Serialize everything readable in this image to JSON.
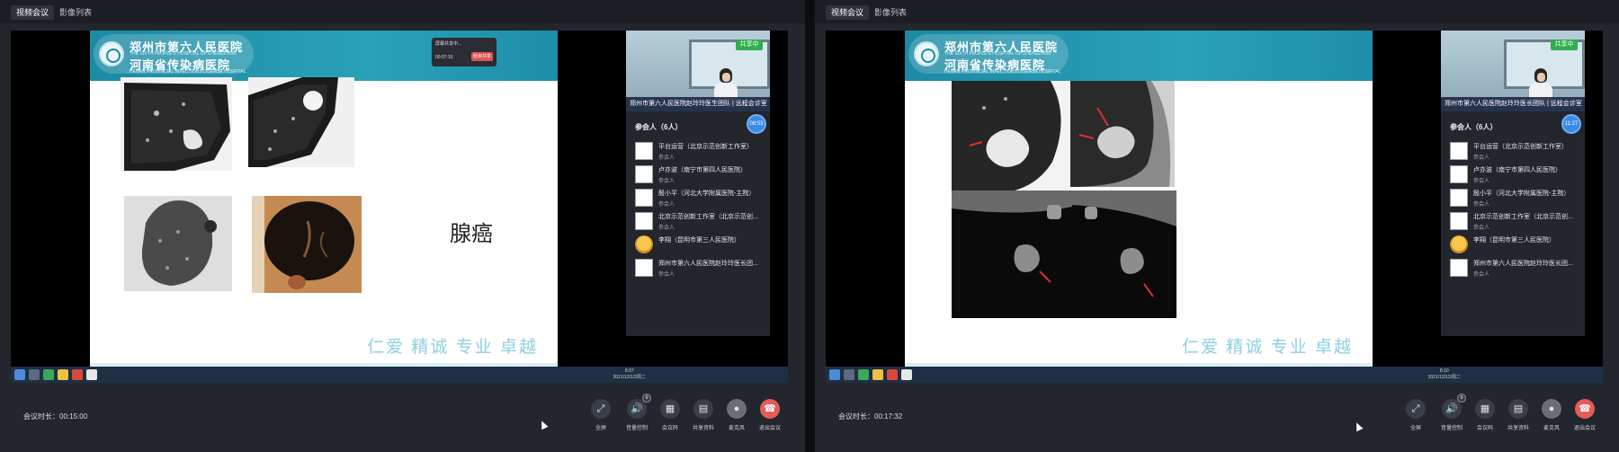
{
  "left": {
    "tabs": [
      {
        "label": "视频会议"
      },
      {
        "label": "影像列表"
      }
    ],
    "slide": {
      "hospital_name_1": "郑州市第六人民医院",
      "hospital_en_1": "THE SIXTH PEOPLE'S HOSPITAL OF ZHENGZHOU",
      "hospital_name_2": "河南省传染病医院",
      "hospital_en_2": "HENAN PROVINCIAL INFECTIOUS DISEASE HOSPITAL",
      "share_popup_title": "屏幕共享中...",
      "share_popup_time": "00:07:10",
      "share_popup_button": "结束共享",
      "diagnosis_label": "腺癌",
      "slogan": "仁爱 精诚 专业 卓越"
    },
    "taskbar_clock": {
      "time": "8:07",
      "date": "2021/12/12/周二"
    },
    "video": {
      "status_badge": "共享中",
      "caption": "郑州市第六人民医院赵玲玲医生团队 | 远程会诊室（..."
    },
    "participants": {
      "title": "参会人（6人）",
      "timer": "08:53",
      "items": [
        {
          "name": "平台运营（北京示范创新工作室）",
          "role": "参会人"
        },
        {
          "name": "卢亦波（南宁市第四人民医院）",
          "role": "参会人"
        },
        {
          "name": "殷小平（河北大学附属医院-主院）",
          "role": "参会人"
        },
        {
          "name": "北京示范创新工作室（北京示范创...",
          "role": "参会人"
        },
        {
          "name": "李翔（昆明市第三人民医院）",
          "role": ""
        },
        {
          "name": "郑州市第六人民医院赵玲玲医长团...",
          "role": "参会人"
        }
      ]
    },
    "footer": {
      "duration_label": "会议时长：",
      "duration_value": "00:15:00",
      "controls": [
        {
          "label": "全屏",
          "icon": "fullscreen-icon"
        },
        {
          "label": "音量控制",
          "icon": "volume-icon"
        },
        {
          "label": "会议码",
          "icon": "qrcode-icon"
        },
        {
          "label": "共享资料",
          "icon": "document-icon"
        },
        {
          "label": "麦克风",
          "icon": "microphone-icon"
        },
        {
          "label": "退出会议",
          "icon": "hangup-icon"
        }
      ],
      "volume_badge": "0"
    }
  },
  "right": {
    "tabs": [
      {
        "label": "视频会议"
      },
      {
        "label": "影像列表"
      }
    ],
    "slide": {
      "hospital_name_1": "郑州市第六人民医院",
      "hospital_en_1": "THE SIXTH PEOPLE'S HOSPITAL OF ZHENGZHOU",
      "hospital_name_2": "河南省传染病医院",
      "hospital_en_2": "HENAN PROVINCIAL INFECTIOUS DISEASE HOSPITAL",
      "slogan": "仁爱 精诚 专业 卓越"
    },
    "taskbar_clock": {
      "time": "8:10",
      "date": "2021/12/12/周二"
    },
    "video": {
      "status_badge": "共享中",
      "caption": "郑州市第六人民医院赵玲玲医长团队 | 远程会诊室（..."
    },
    "participants": {
      "title": "参会人（6人）",
      "timer": "11:27",
      "items": [
        {
          "name": "平台运营（北京示范创新工作室）",
          "role": "参会人"
        },
        {
          "name": "卢亦波（南宁市第四人民医院）",
          "role": "参会人"
        },
        {
          "name": "殷小平（河北大学附属医院-主院）",
          "role": "参会人"
        },
        {
          "name": "北京示范创新工作室（北京示范创...",
          "role": "参会人"
        },
        {
          "name": "李翔（昆明市第三人民医院）",
          "role": ""
        },
        {
          "name": "郑州市第六人民医院赵玲玲医长团...",
          "role": "参会人"
        }
      ]
    },
    "footer": {
      "duration_label": "会议时长：",
      "duration_value": "00:17:32",
      "controls": [
        {
          "label": "全屏",
          "icon": "fullscreen-icon"
        },
        {
          "label": "音量控制",
          "icon": "volume-icon"
        },
        {
          "label": "会议码",
          "icon": "qrcode-icon"
        },
        {
          "label": "共享资料",
          "icon": "document-icon"
        },
        {
          "label": "麦克风",
          "icon": "microphone-icon"
        },
        {
          "label": "退出会议",
          "icon": "hangup-icon"
        }
      ],
      "volume_badge": "0"
    }
  },
  "colors": {
    "accent_blue": "#3a8be4",
    "live_green": "#2fae4f",
    "exit_red": "#e45c58",
    "slogan_teal": "#8ecfe0"
  }
}
